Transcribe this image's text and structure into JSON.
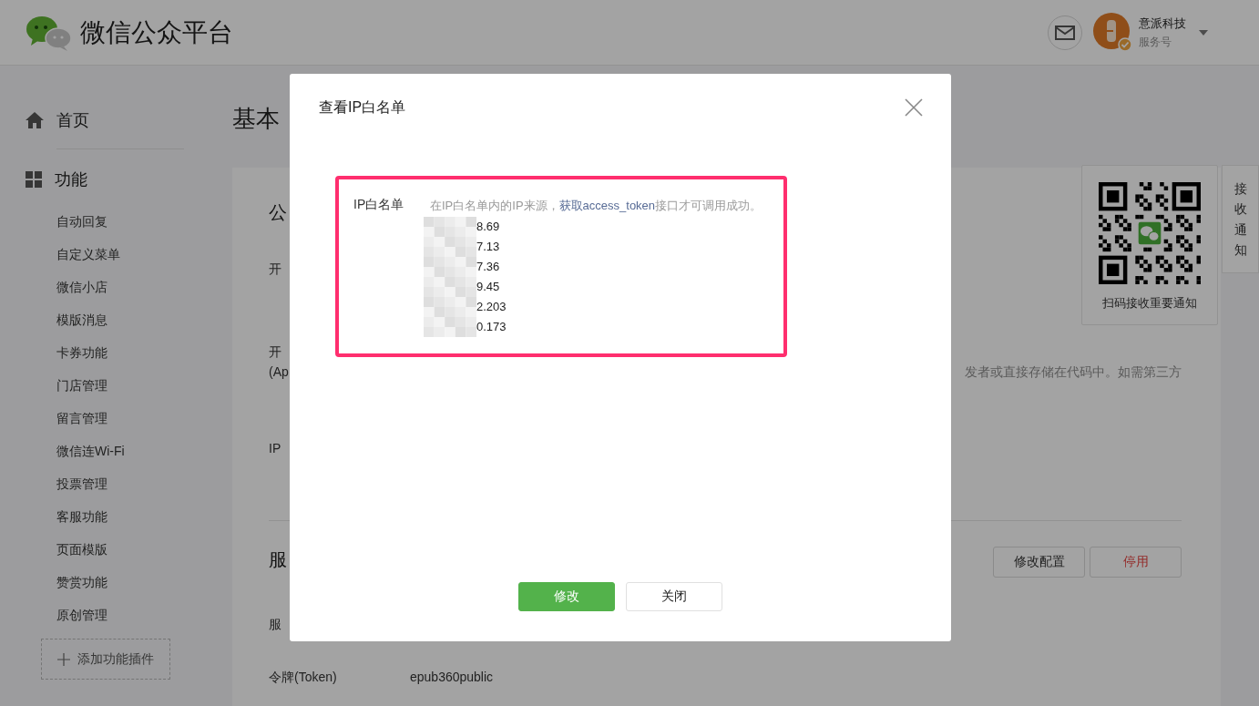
{
  "header": {
    "title": "微信公众平台",
    "account": {
      "name": "意派科技",
      "type": "服务号"
    }
  },
  "sidebar": {
    "home": "首页",
    "section": "功能",
    "items": [
      "自动回复",
      "自定义菜单",
      "微信小店",
      "模版消息",
      "卡券功能",
      "门店管理",
      "留言管理",
      "微信连Wi-Fi",
      "投票管理",
      "客服功能",
      "页面模版",
      "赞赏功能",
      "原创管理"
    ],
    "add_button": "添加功能插件"
  },
  "page": {
    "title": "基本",
    "section1": {
      "heading": "公",
      "rows": [
        {
          "lines": [
            "开"
          ]
        },
        {
          "lines": [
            "开",
            "(Ap"
          ],
          "value": "发者或直接存储在代码中。如需第三方"
        },
        {
          "lines": [
            "IP"
          ]
        }
      ]
    },
    "section2": {
      "heading": "服",
      "buttons": [
        {
          "label": "修改配置",
          "kind": "default"
        },
        {
          "label": "停用",
          "kind": "danger"
        }
      ],
      "rows": [
        {
          "lines": [
            "服"
          ]
        },
        {
          "lines": [
            "令牌(Token)"
          ],
          "value": "epub360public"
        }
      ]
    }
  },
  "qr_card": {
    "caption": "扫码接收重要通知"
  },
  "notice_tab": {
    "label": "接收通知"
  },
  "dialog": {
    "title": "查看IP白名单",
    "field": {
      "label": "IP白名单",
      "hint_before": "在IP白名单内的IP来源，",
      "link": "获取access_token",
      "hint_after": "接口才可调用成功。"
    },
    "ips": [
      "8.69",
      "7.13",
      "7.36",
      "9.45",
      "2.203",
      "0.173"
    ],
    "buttons": [
      {
        "label": "修改",
        "kind": "primary"
      },
      {
        "label": "关闭",
        "kind": "default"
      }
    ]
  }
}
